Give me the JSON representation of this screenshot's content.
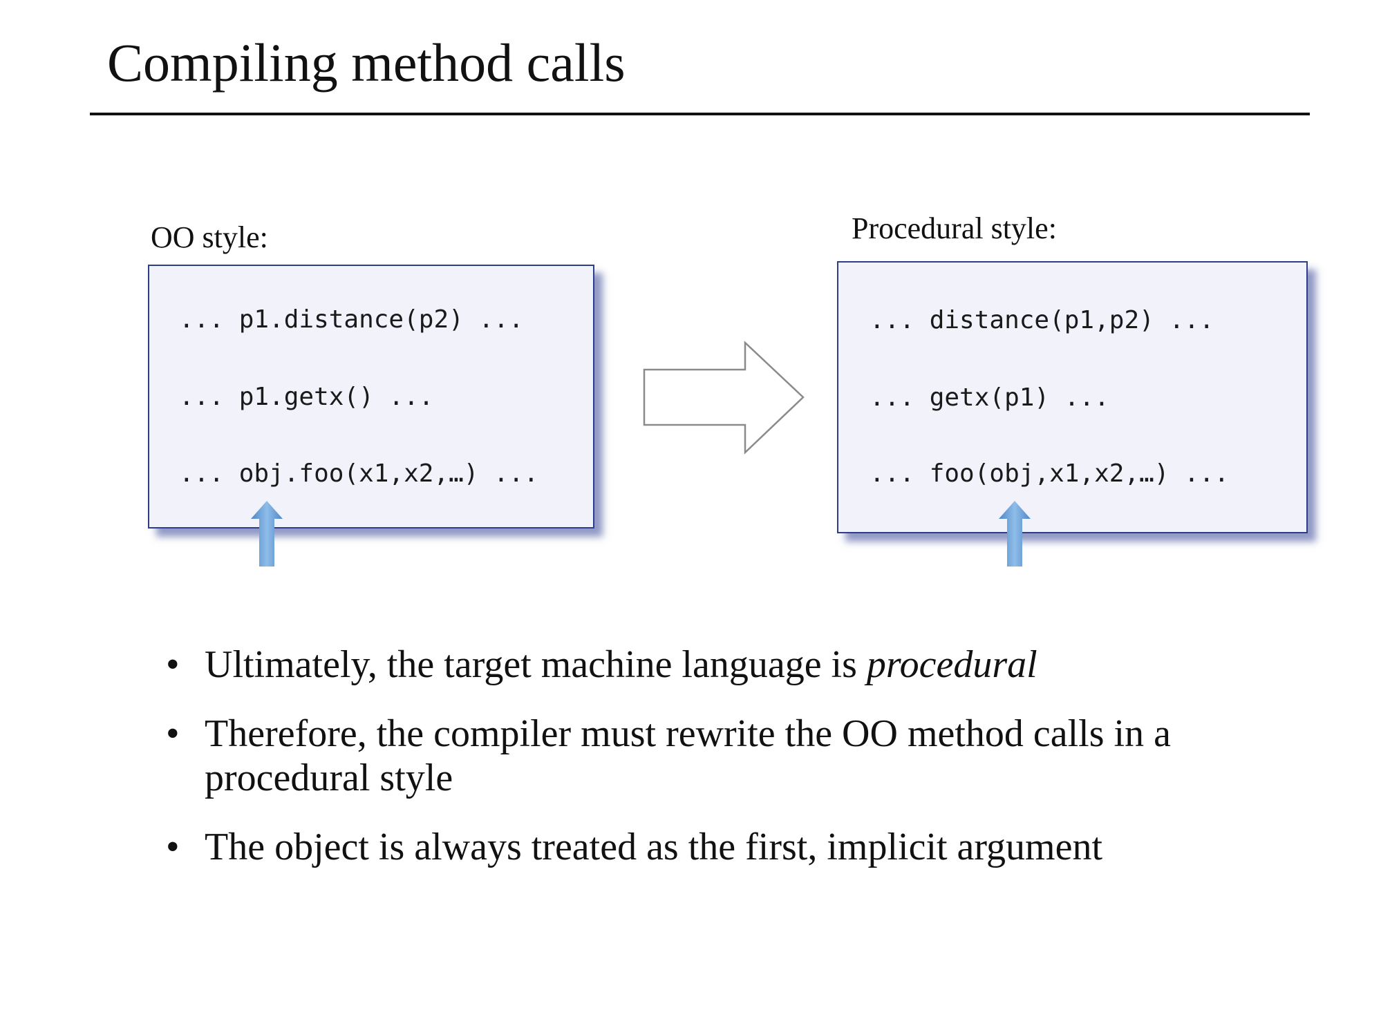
{
  "slide": {
    "title": "Compiling method calls"
  },
  "oo_panel": {
    "label": "OO style:",
    "lines": [
      "... p1.distance(p2) ...",
      "... p1.getx() ...",
      "... obj.foo(x1,x2,…) ..."
    ]
  },
  "procedural_panel": {
    "label": "Procedural style:",
    "lines": [
      "... distance(p1,p2) ...",
      "... getx(p1) ...",
      "... foo(obj,x1,x2,…) ..."
    ]
  },
  "colors": {
    "box_fill": "#f2f2fb",
    "box_border": "#2e3d8a",
    "pointer_arrow": "#6aa2d8"
  },
  "icons": {
    "transform_arrow": "right-arrow-outline-icon",
    "pointer": "up-arrow-icon"
  },
  "bullets": [
    {
      "text": "Ultimately, the target machine language is ",
      "emphasis": "procedural"
    },
    {
      "text": "Therefore, the compiler must rewrite the OO method calls in a procedural style",
      "emphasis": ""
    },
    {
      "text": "The object is always treated as the first, implicit argument",
      "emphasis": ""
    }
  ],
  "bullet_symbol": "•"
}
